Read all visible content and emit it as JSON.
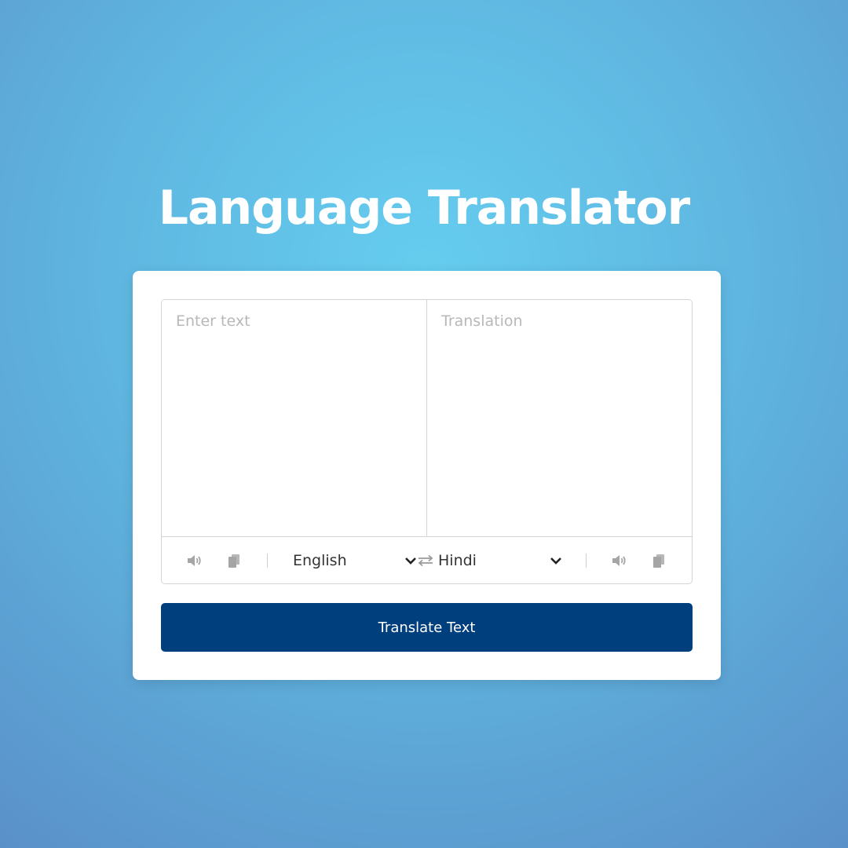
{
  "header": {
    "title": "Language Translator"
  },
  "input": {
    "from_placeholder": "Enter text",
    "to_placeholder": "Translation"
  },
  "controls": {
    "from_language": "English",
    "to_language": "Hindi",
    "icons": [
      "volume-icon",
      "copy-icon",
      "exchange-icon",
      "chevron-down-icon"
    ]
  },
  "actions": {
    "translate_label": "Translate Text"
  },
  "colors": {
    "button": "#003f7e",
    "background_center": "#65cdef",
    "background_edge": "#5a90c8"
  }
}
